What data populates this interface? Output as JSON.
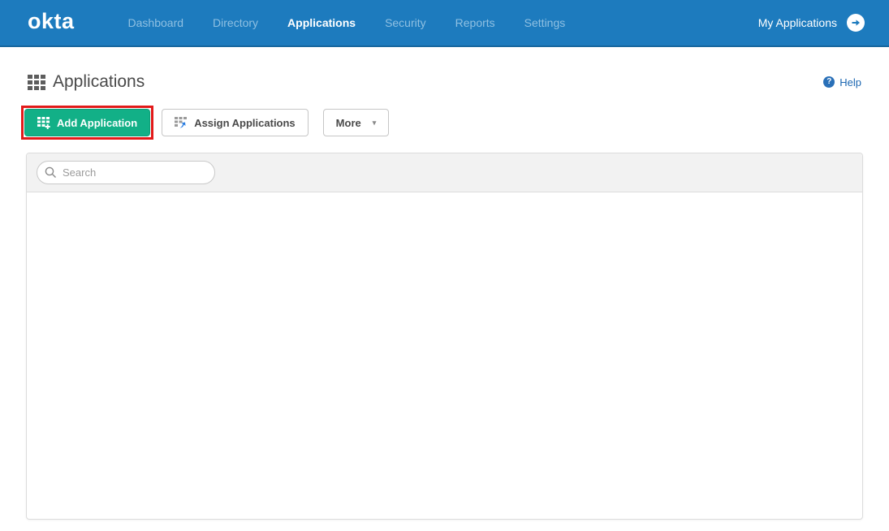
{
  "navbar": {
    "logo": "okta",
    "items": [
      {
        "label": "Dashboard",
        "active": false
      },
      {
        "label": "Directory",
        "active": false
      },
      {
        "label": "Applications",
        "active": true
      },
      {
        "label": "Security",
        "active": false
      },
      {
        "label": "Reports",
        "active": false
      },
      {
        "label": "Settings",
        "active": false
      }
    ],
    "my_applications_label": "My Applications"
  },
  "page": {
    "title": "Applications",
    "help_label": "Help",
    "help_glyph": "?"
  },
  "toolbar": {
    "add_application_label": "Add Application",
    "assign_applications_label": "Assign Applications",
    "more_label": "More",
    "more_caret": "▾"
  },
  "search": {
    "placeholder": "Search",
    "value": ""
  },
  "icons": {
    "title_icon": "grid-icon",
    "add_icon": "grid-plus-icon",
    "assign_icon": "grid-arrow-icon",
    "nav_arrow": "arrow-right-circle-icon",
    "search_icon": "magnifier-icon"
  },
  "colors": {
    "navbar_blue": "#1d7bbe",
    "navbar_border": "#17679e",
    "nav_inactive_text": "#8fc0e2",
    "green_button": "#12b087",
    "annotation_red": "#e21a1a",
    "link_blue": "#1b66b1",
    "panel_header_gray": "#f2f2f2",
    "title_gray": "#4a4a4a"
  }
}
